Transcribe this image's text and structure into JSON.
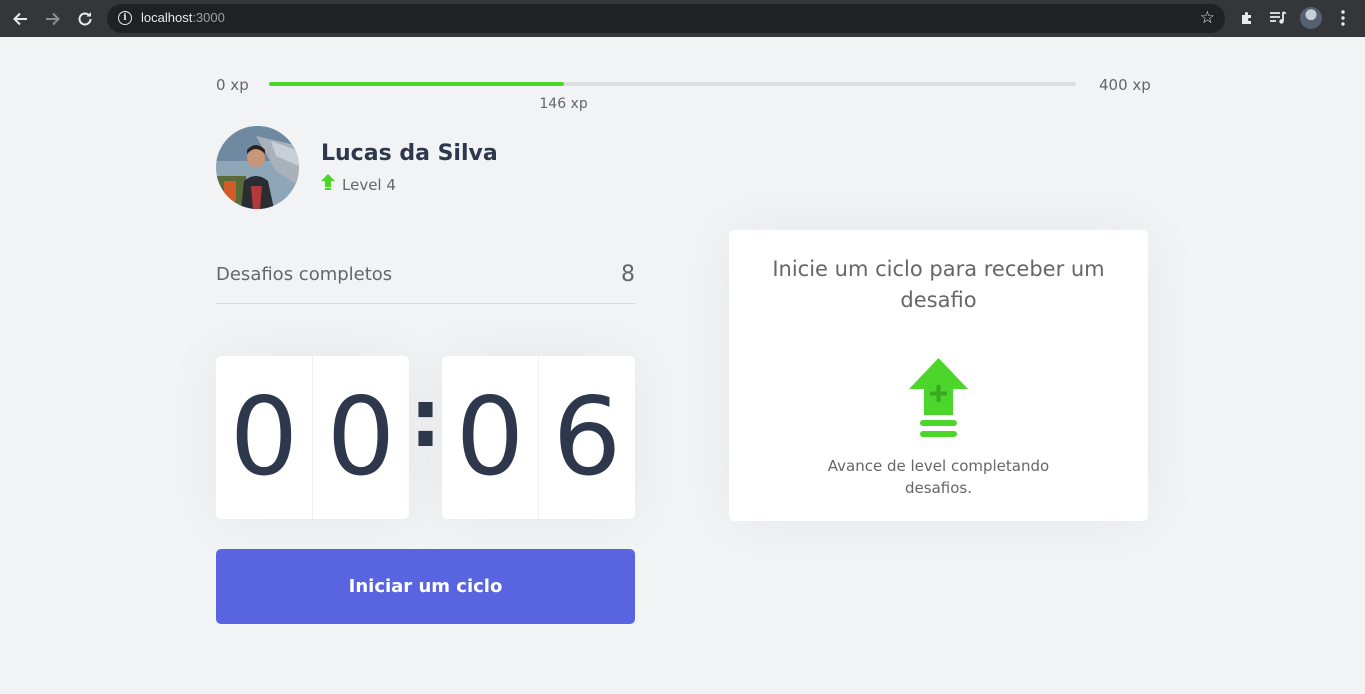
{
  "browser": {
    "back_icon": "arrow-left",
    "forward_icon": "arrow-right",
    "reload_icon": "reload",
    "url_host": "localhost",
    "url_port": ":3000",
    "bookmark_icon": "star",
    "extensions_icon": "puzzle-piece",
    "media_icon": "playlist-music",
    "profile_icon": "avatar",
    "menu_icon": "three-dots-vertical"
  },
  "xp": {
    "min_label": "0 xp",
    "max_label": "400 xp",
    "current_label": "146 xp",
    "current_value": 146,
    "max_value": 400,
    "fill_color": "#4cd62b"
  },
  "profile": {
    "name": "Lucas da Silva",
    "level_label": "Level 4",
    "level_icon": "up-arrow",
    "level_icon_color": "#4cd62b"
  },
  "stats": {
    "completed_label": "Desafios completos",
    "completed_value": "8"
  },
  "countdown": {
    "minute_tens": "0",
    "minute_ones": "0",
    "separator": ":",
    "second_tens": "0",
    "second_ones": "6"
  },
  "actions": {
    "start_label": "Iniciar um ciclo",
    "start_color": "#5965e0"
  },
  "challenge_box": {
    "title": "Inicie um ciclo para receber um desafio",
    "icon": "level-up-arrow",
    "description": "Avance de level completando desafios."
  }
}
